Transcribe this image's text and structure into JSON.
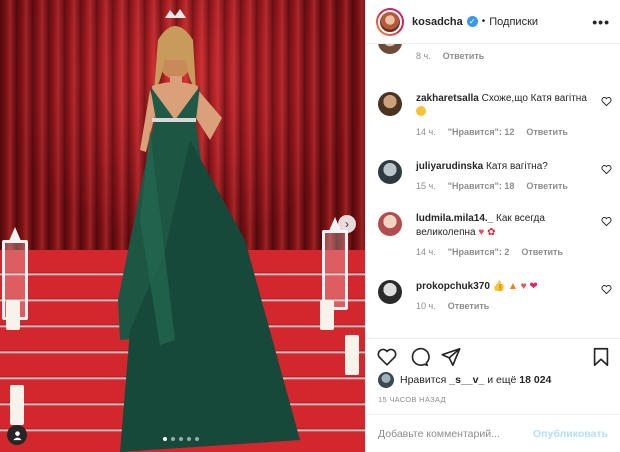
{
  "post": {
    "photo_alt": "Woman in long green gown on red staircase",
    "carousel_dots": 5,
    "active_dot": 0
  },
  "header": {
    "username": "kosadcha",
    "separator": "•",
    "follow_label": "Подписки",
    "more_label": "•••"
  },
  "comments": [
    {
      "user": "",
      "text": "",
      "time": "8 ч.",
      "likes": "",
      "reply": "Ответить"
    },
    {
      "user": "zakharetsalla",
      "text": "Схоже,що Катя вагітна",
      "time": "14 ч.",
      "likes": "\"Нравится\": 12",
      "reply": "Ответить"
    },
    {
      "user": "juliyarudinska",
      "text": "Катя вагітна?",
      "time": "15 ч.",
      "likes": "\"Нравится\": 18",
      "reply": "Ответить"
    },
    {
      "user": "ludmila.mila14._",
      "text": "Как всегда великолепна",
      "time": "14 ч.",
      "likes": "\"Нравится\": 2",
      "reply": "Ответить"
    },
    {
      "user": "prokopchuk370",
      "text": "",
      "time": "10 ч.",
      "likes": "",
      "reply": "Ответить"
    }
  ],
  "likes": {
    "prefix": "Нравится",
    "user": "_s__v_",
    "middle": "и ещё",
    "count": "18 024"
  },
  "timestamp": "15 ЧАСОВ НАЗАД",
  "composer": {
    "placeholder": "Добавьте комментарий...",
    "publish_label": "Опубликовать"
  },
  "colors": {
    "accent_blue": "#3897f0",
    "publish_disabled": "#b2dffc",
    "muted": "#8e8e8e",
    "heart_red": "#ed4956"
  }
}
